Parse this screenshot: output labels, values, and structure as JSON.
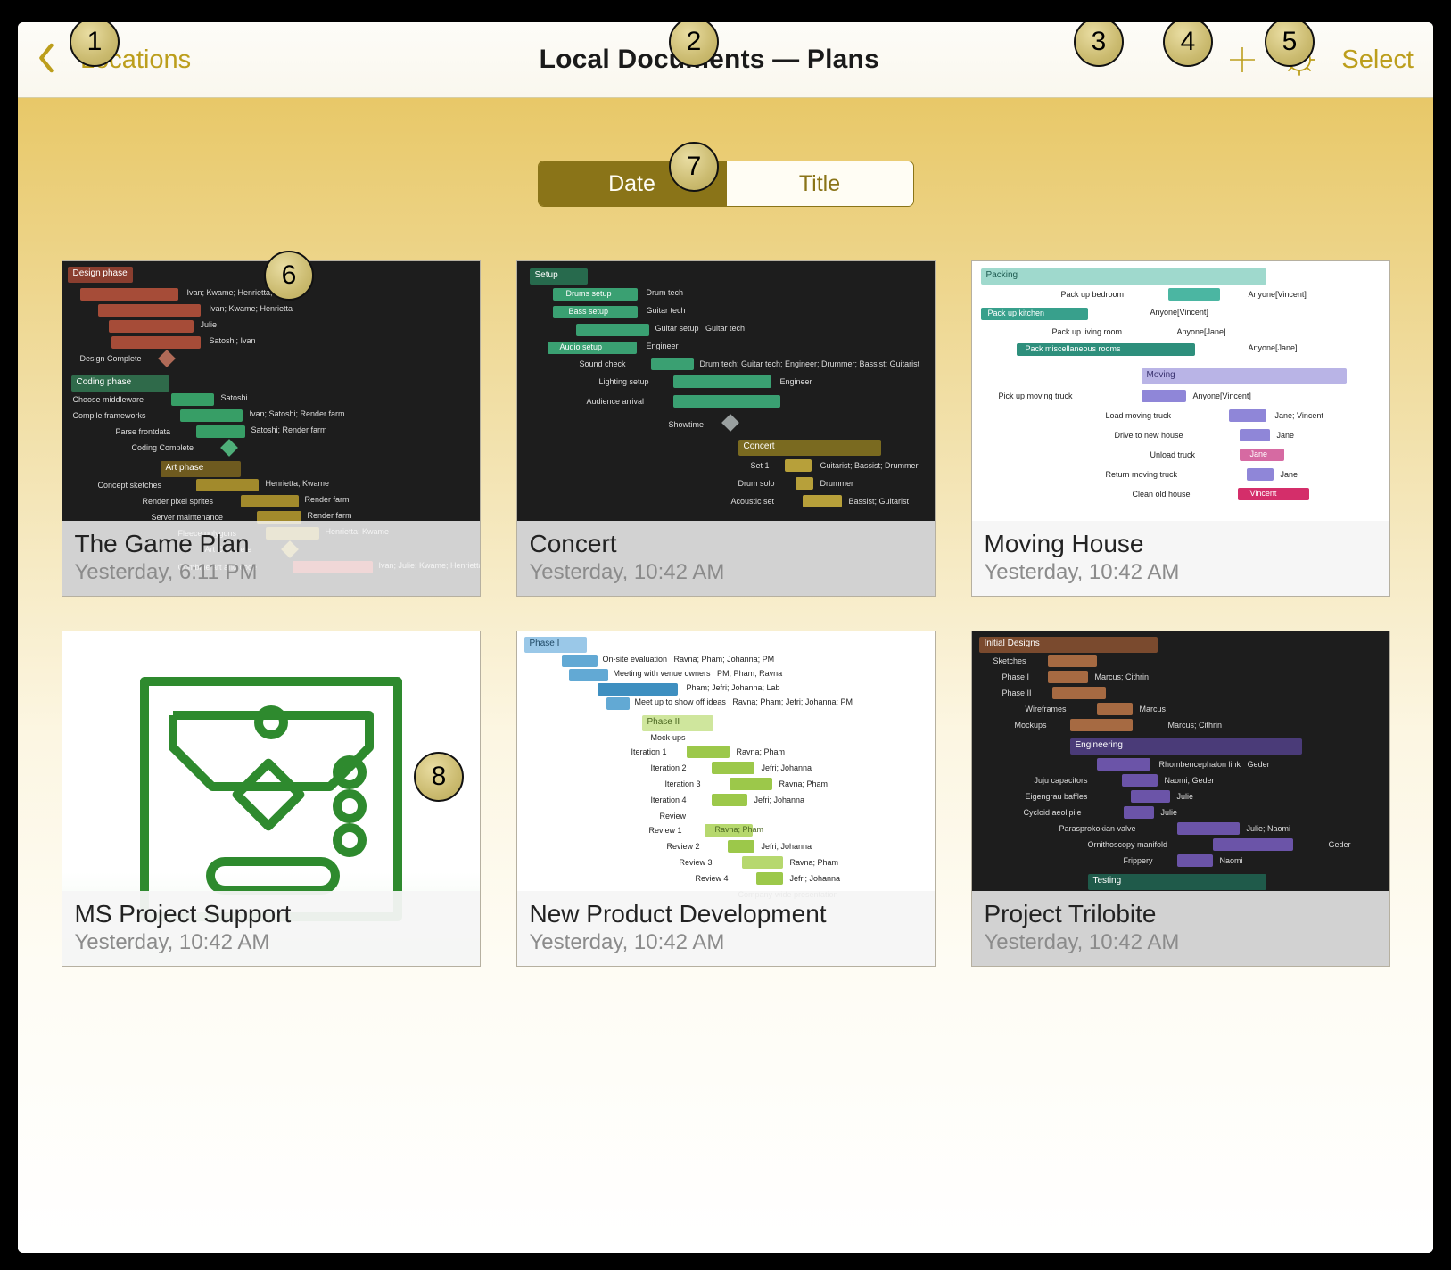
{
  "nav": {
    "back_label": "Locations",
    "title": "Local Documents — Plans",
    "select_label": "Select"
  },
  "sort": {
    "options": [
      "Date",
      "Title"
    ],
    "active_index": 0
  },
  "documents": [
    {
      "title": "The Game Plan",
      "subtitle": "Yesterday, 6:11 PM"
    },
    {
      "title": "Concert",
      "subtitle": "Yesterday, 10:42 AM"
    },
    {
      "title": "Moving House",
      "subtitle": "Yesterday, 10:42 AM"
    },
    {
      "title": "MS Project Support",
      "subtitle": "Yesterday, 10:42 AM"
    },
    {
      "title": "New Product Development",
      "subtitle": "Yesterday, 10:42 AM"
    },
    {
      "title": "Project Trilobite",
      "subtitle": "Yesterday, 10:42 AM"
    }
  ],
  "callouts": [
    "1",
    "2",
    "3",
    "4",
    "5",
    "6",
    "7",
    "8"
  ]
}
